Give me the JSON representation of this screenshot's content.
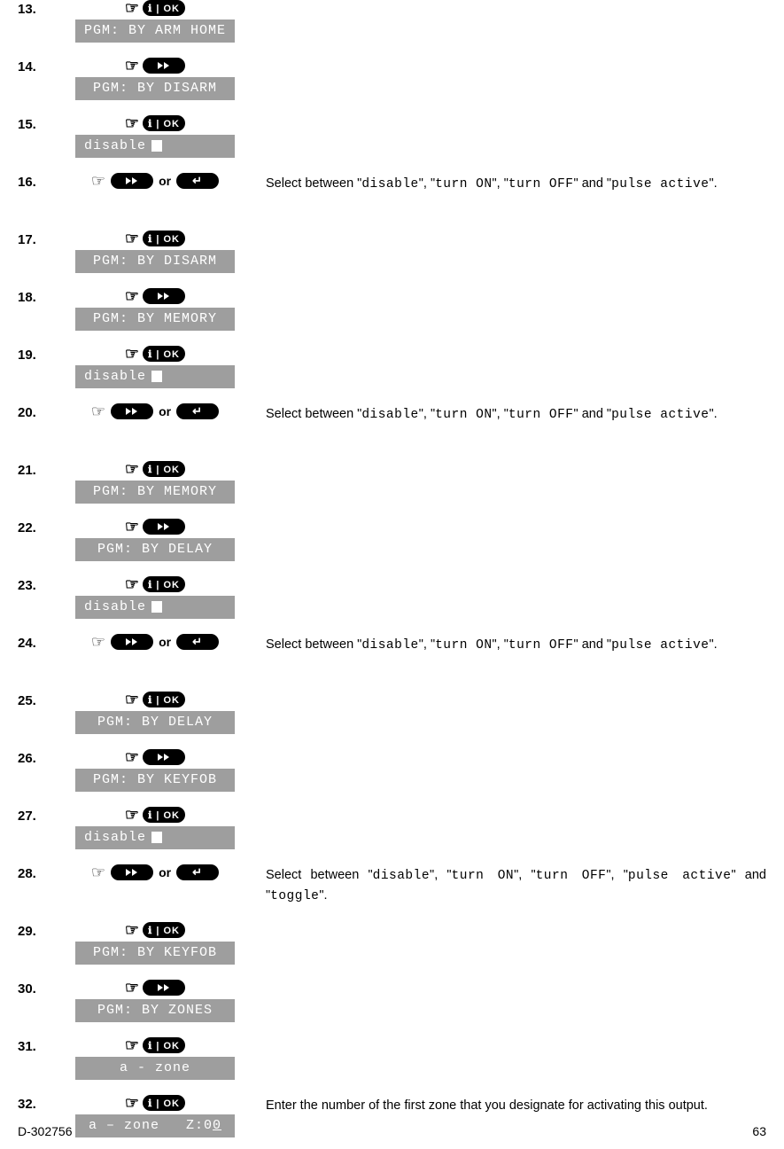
{
  "steps": [
    {
      "num": "13.",
      "icon": "ok",
      "display": "PGM: BY ARM HOME",
      "desc": ""
    },
    {
      "num": "14.",
      "icon": "next",
      "display": "PGM: BY DISARM",
      "desc": ""
    },
    {
      "num": "15.",
      "icon": "ok",
      "display": "disable",
      "cursor": true,
      "desc": ""
    },
    {
      "num": "16.",
      "icon": "nav-or",
      "desc_type": "select4"
    },
    {
      "num": "17.",
      "icon": "ok",
      "display": "PGM: BY DISARM",
      "desc": ""
    },
    {
      "num": "18.",
      "icon": "next",
      "display": "PGM: BY MEMORY",
      "desc": ""
    },
    {
      "num": "19.",
      "icon": "ok",
      "display": "disable",
      "cursor": true,
      "desc": ""
    },
    {
      "num": "20.",
      "icon": "nav-or",
      "desc_type": "select4"
    },
    {
      "num": "21.",
      "icon": "ok",
      "display": "PGM: BY MEMORY",
      "desc": ""
    },
    {
      "num": "22.",
      "icon": "next",
      "display": "PGM: BY DELAY",
      "desc": ""
    },
    {
      "num": "23.",
      "icon": "ok",
      "display": "disable",
      "cursor": true,
      "desc": ""
    },
    {
      "num": "24.",
      "icon": "nav-or",
      "desc_type": "select4"
    },
    {
      "num": "25.",
      "icon": "ok",
      "display": "PGM: BY DELAY",
      "desc": ""
    },
    {
      "num": "26.",
      "icon": "next",
      "display": "PGM: BY KEYFOB",
      "desc": ""
    },
    {
      "num": "27.",
      "icon": "ok",
      "display": "disable",
      "cursor": true,
      "desc": ""
    },
    {
      "num": "28.",
      "icon": "nav-or",
      "desc_type": "select5"
    },
    {
      "num": "29.",
      "icon": "ok",
      "display": "PGM: BY KEYFOB",
      "desc": ""
    },
    {
      "num": "30.",
      "icon": "next",
      "display": "PGM: BY ZONES",
      "desc": ""
    },
    {
      "num": "31.",
      "icon": "ok",
      "display": "a - zone",
      "desc": ""
    },
    {
      "num": "32.",
      "icon": "ok",
      "display": "a – zone   Z:00",
      "underline_last": true,
      "desc_type": "enterzone"
    }
  ],
  "strings": {
    "or": "or",
    "ok": "ℹ | OK",
    "select4_pre": "Select between \"",
    "opt_disable": "disable",
    "q_comma_q": "\", \"",
    "opt_on": "turn ON",
    "opt_off": "turn OFF",
    "q_and_q": "\" and \"",
    "opt_pulse": "pulse active",
    "q_end": "\".",
    "opt_toggle": "toggle",
    "enterzone": "Enter the number of the first zone that you designate for activating this output."
  },
  "footer": {
    "left": "D-302756",
    "right": "63"
  }
}
